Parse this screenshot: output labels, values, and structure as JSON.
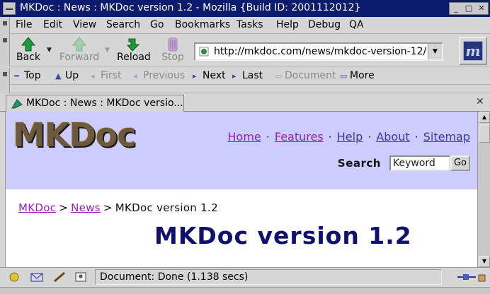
{
  "window": {
    "title": "MKDoc : News : MKDoc version 1.2 - Mozilla {Build ID: 2001112012}"
  },
  "menu": [
    "File",
    "Edit",
    "View",
    "Search",
    "Go",
    "Bookmarks",
    "Tasks",
    "Help",
    "Debug",
    "QA"
  ],
  "nav": {
    "back": "Back",
    "forward": "Forward",
    "reload": "Reload",
    "stop": "Stop"
  },
  "url": "http://mkdoc.com/news/mkdoc-version-12/",
  "sitebar": {
    "top": "Top",
    "up": "Up",
    "first": "First",
    "previous": "Previous",
    "next": "Next",
    "last": "Last",
    "document": "Document",
    "more": "More"
  },
  "tab": {
    "title": "MKDoc : News : MKDoc versio..."
  },
  "page": {
    "logo": "MKDoc",
    "sitenav": [
      "Home",
      "Features",
      "Help",
      "About",
      "Sitemap"
    ],
    "search_label": "Search",
    "search_value": "Keyword",
    "go_label": "Go",
    "breadcrumb": [
      "MKDoc",
      "News",
      "MKDoc version 1.2"
    ],
    "heading": "MKDoc version 1.2"
  },
  "status": {
    "text": "Document: Done (1.138 secs)"
  },
  "colors": {
    "titlebar": "#0b1c6e",
    "banner": "#ccccff",
    "link": "#9b1fbd",
    "heading": "#101070"
  }
}
